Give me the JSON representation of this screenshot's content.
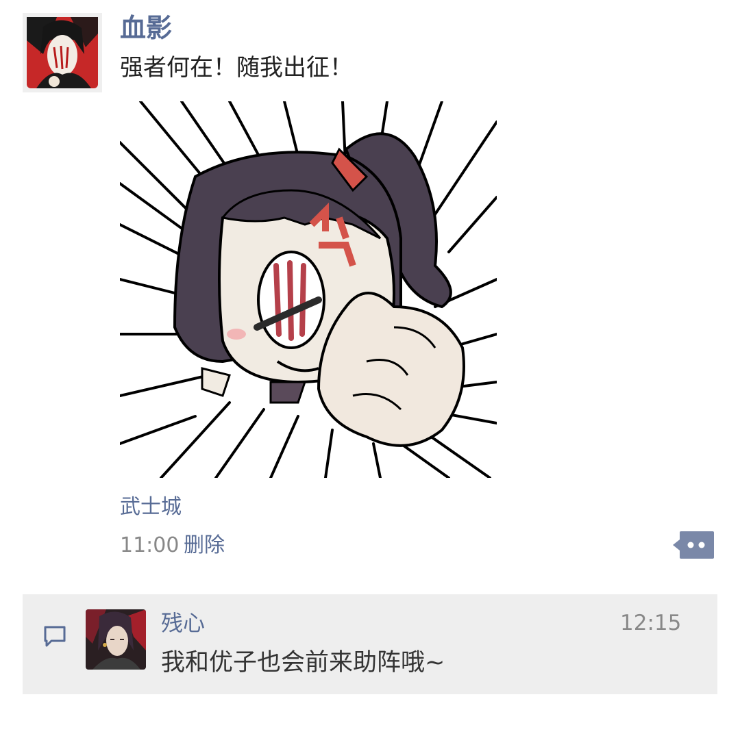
{
  "post": {
    "author": "血影",
    "text": "强者何在！随我出征！",
    "location": "武士城",
    "time": "11:00",
    "delete_label": "删除"
  },
  "comments": [
    {
      "author": "残心",
      "time": "12:15",
      "text": "我和优子也会前来助阵哦~"
    }
  ],
  "colors": {
    "link": "#576b95",
    "comment_bg": "#eeeeee"
  },
  "icons": {
    "more": "ellipsis-bubble-icon",
    "comment": "comment-bubble-icon"
  }
}
